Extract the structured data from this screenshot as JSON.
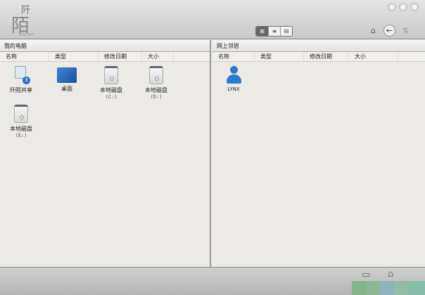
{
  "app": {
    "logo_char1": "阡",
    "logo_char2": "陌",
    "logo_sub": "QIAN MO"
  },
  "toolbar": {
    "views": [
      "icon-view",
      "list-view",
      "column-view"
    ]
  },
  "left": {
    "title": "我的电脑",
    "columns": [
      "名称",
      "类型",
      "修改日期",
      "大小"
    ],
    "items": [
      {
        "name": "阡陌共享",
        "badge": "3"
      },
      {
        "name": "桌面"
      },
      {
        "name": "本地磁盘",
        "sub": "(C:)"
      },
      {
        "name": "本地磁盘",
        "sub": "(D:)"
      },
      {
        "name": "本地磁盘",
        "sub": "(E:)"
      }
    ]
  },
  "right": {
    "title": "网上邻居",
    "columns": [
      "名称",
      "类型",
      "修改日期",
      "大小"
    ],
    "items": [
      {
        "name": "LYNX"
      }
    ]
  },
  "colors": {
    "swatches": [
      "#84b48c",
      "#8fb694",
      "#8fb3bc",
      "#94bca4",
      "#88bcaa"
    ]
  }
}
